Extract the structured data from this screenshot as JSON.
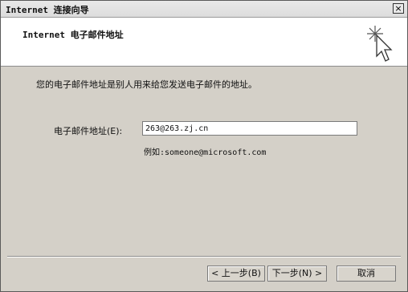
{
  "window": {
    "title": "Internet 连接向导",
    "close_glyph": "×"
  },
  "header": {
    "title": "Internet 电子邮件地址",
    "icon": "wizard-cursor-sparkle-icon"
  },
  "main": {
    "description": "您的电子邮件地址是别人用来给您发送电子邮件的地址。",
    "email_label": "电子邮件地址(E):",
    "email_value": "263@263.zj.cn",
    "example": "例如:someone@microsoft.com"
  },
  "buttons": {
    "back": "< 上一步(B)",
    "next": "下一步(N) >",
    "cancel": "取消"
  }
}
